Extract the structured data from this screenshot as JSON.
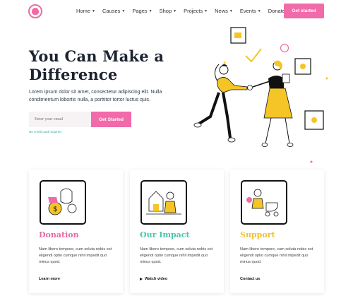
{
  "nav": {
    "items": [
      {
        "label": "Home"
      },
      {
        "label": "Causes"
      },
      {
        "label": "Pages"
      },
      {
        "label": "Shop"
      },
      {
        "label": "Projects"
      },
      {
        "label": "News"
      },
      {
        "label": "Events"
      },
      {
        "label": "Donate"
      }
    ],
    "cta": "Get started"
  },
  "hero": {
    "title_line1": "You Can Make a",
    "title_line2": "Difference",
    "text": "Lorem ipsum dolor sit amet, consectetur adipiscing elit. Nulla condimentum lobortis nulla, a porttitor tortor luctus quis.",
    "email_placeholder": "Enter your email",
    "button": "Get Started",
    "note": "No credit card required"
  },
  "cards": [
    {
      "title": "Donation",
      "text": "Nam libero tempore, cum soluta nobis est eligendi optio cumque nihil impedit quo minus quod.",
      "link": "Learn more",
      "accent": "#e46aa8"
    },
    {
      "title": "Our Impact",
      "text": "Nam libero tempore, cum soluta nobis est eligendi optio cumque nihil impedit quo minus quod.",
      "link": "Watch video",
      "accent": "#4cc3b0"
    },
    {
      "title": "Support",
      "text": "Nam libero tempore, cum soluta nobis est eligendi optio cumque nihil impedit quo minus quod.",
      "link": "Contact us",
      "accent": "#f1c12f"
    }
  ],
  "colors": {
    "brand": "#f16aa9",
    "teal": "#4cc3b0",
    "yellow": "#f5c525",
    "dark": "#1b2330"
  }
}
